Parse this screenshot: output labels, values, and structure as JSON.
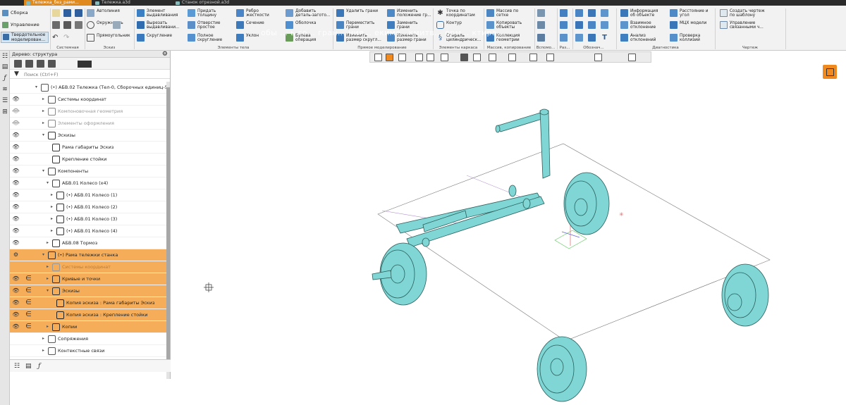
{
  "tabs": [
    "Тележка_без_рами...",
    "Тележка.a3d",
    "Станок отрезной.a3d"
  ],
  "mode_panel": {
    "items": [
      "Сборка",
      "Управление",
      "Твердотельное моделирован..."
    ]
  },
  "ribbon": {
    "group_titles": [
      "Системная",
      "Эскиз",
      "Элементы тела",
      "Прямое моделирование",
      "Элементы каркаса",
      "Массив, копирование",
      "Вспомо...",
      "Раз...",
      "Обознач...",
      "Диагностика",
      "Чертеж"
    ],
    "eskiz": [
      "Автолиния",
      "Окружность",
      "Прямоугольник",
      "Скругление"
    ],
    "body": [
      "Элемент\nвыдавливания",
      "Придать\nтолщину",
      "Ребро\nжесткости",
      "Добавить\nдеталь-загото...",
      "Вырезать\nвыдавливани...",
      "Отверстие\nпростое",
      "Сечение",
      "Оболочка",
      "Скругление",
      "Полное\nскругление",
      "Уклон",
      "Булева\nоперация"
    ],
    "direct": [
      "Удалить грани",
      "Переместить\nграни",
      "Изменить\nразмер скругл...",
      "Изменить\nположение гр...",
      "Заменить\nграни",
      "Изменить\nразмер грани"
    ],
    "frame": [
      "Точка по\nкоординатам",
      "Контур",
      "Спираль\nцилиндрическ..."
    ],
    "array": [
      "Массив по\nсетке",
      "Копировать\nобъекты",
      "Коллекция\nгеометрии"
    ],
    "diag": [
      "Информация\nоб объекте",
      "Взаимное\nотклонение",
      "Анализ\nотклонений",
      "Расстояние и\nугол",
      "МЦХ модели",
      "Проверка\nколлизий"
    ],
    "drawing": [
      "Создать чертеж\nпо шаблону",
      "Управление\nсвязанными ч..."
    ]
  },
  "ghost_text": "обы ... ь го... гран... ния... екиме...кмитв... орм... ктира...",
  "tree": {
    "title": "Дерево: структура",
    "search_placeholder": "Поиск (Ctrl+F)",
    "rows": [
      {
        "label": "(•) АБВ.02 Тележка (Тел-0, Сборочных единиц-5",
        "style": "",
        "sel": false,
        "eye": "",
        "eps": false
      },
      {
        "label": "Системы координат",
        "style": "",
        "sel": false,
        "eye": "open",
        "eps": false
      },
      {
        "label": "Компоновочная геометрия",
        "style": "grey",
        "sel": false,
        "eye": "off",
        "eps": false
      },
      {
        "label": "Элементы оформления",
        "style": "grey",
        "sel": false,
        "eye": "off",
        "eps": false
      },
      {
        "label": "Эскизы",
        "style": "",
        "sel": false,
        "eye": "open",
        "eps": false
      },
      {
        "label": "Рама габариты Эскиз",
        "style": "",
        "sel": false,
        "eye": "open",
        "eps": false
      },
      {
        "label": "Крепление стойки",
        "style": "",
        "sel": false,
        "eye": "open",
        "eps": false
      },
      {
        "label": "Компоненты",
        "style": "",
        "sel": false,
        "eye": "open",
        "eps": false
      },
      {
        "label": "АБВ.01 Колесо (x4)",
        "style": "",
        "sel": false,
        "eye": "open",
        "eps": false
      },
      {
        "label": "(•) АБВ.01 Колесо (1)",
        "style": "",
        "sel": false,
        "eye": "open",
        "eps": false
      },
      {
        "label": "(•) АБВ.01 Колесо (2)",
        "style": "",
        "sel": false,
        "eye": "open",
        "eps": false
      },
      {
        "label": "(•) АБВ.01 Колесо (3)",
        "style": "",
        "sel": false,
        "eye": "open",
        "eps": false
      },
      {
        "label": "(•) АБВ.01 Колесо (4)",
        "style": "",
        "sel": false,
        "eye": "open",
        "eps": false
      },
      {
        "label": "АБВ.08 Тормоз",
        "style": "",
        "sel": false,
        "eye": "open",
        "eps": false
      },
      {
        "label": "(•) Рама тележки станка",
        "style": "",
        "sel": true,
        "eye": "gear",
        "eps": false
      },
      {
        "label": "Системы координат",
        "style": "sgrey",
        "sel": true,
        "eye": "",
        "eps": false
      },
      {
        "label": "Кривые и точки",
        "style": "",
        "sel": true,
        "eye": "open",
        "eps": true
      },
      {
        "label": "Эскизы",
        "style": "",
        "sel": true,
        "eye": "open",
        "eps": true
      },
      {
        "label": "Копия эскиза : Рама габариты Эскиз",
        "style": "",
        "sel": true,
        "eye": "open",
        "eps": true
      },
      {
        "label": "Копия эскиза : Крепление стойки",
        "style": "",
        "sel": true,
        "eye": "open",
        "eps": true
      },
      {
        "label": "Копии",
        "style": "",
        "sel": true,
        "eye": "open",
        "eps": true
      },
      {
        "label": "Сопряжения",
        "style": "",
        "sel": false,
        "eye": "",
        "eps": false
      },
      {
        "label": "Контекстные связи",
        "style": "",
        "sel": false,
        "eye": "",
        "eps": false
      }
    ]
  },
  "colors": {
    "accent": "#f08a1e",
    "selection": "#f5ad59",
    "model": "#7fd6d4",
    "model_edge": "#2a5e5c"
  }
}
